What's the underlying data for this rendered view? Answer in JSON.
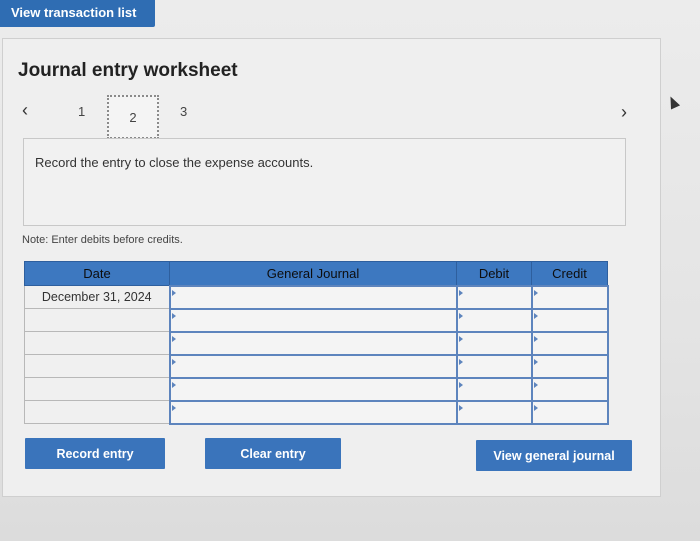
{
  "top": {
    "view_transactions_label": "View transaction list"
  },
  "worksheet": {
    "title": "Journal entry worksheet",
    "steps": [
      "1",
      "2",
      "3"
    ],
    "active_step": "2",
    "instruction": "Record the entry to close the expense accounts.",
    "note": "Note: Enter debits before credits."
  },
  "table": {
    "headers": {
      "date": "Date",
      "general_journal": "General Journal",
      "debit": "Debit",
      "credit": "Credit"
    },
    "rows": [
      {
        "date": "December 31, 2024",
        "account": "",
        "debit": "",
        "credit": ""
      },
      {
        "date": "",
        "account": "",
        "debit": "",
        "credit": ""
      },
      {
        "date": "",
        "account": "",
        "debit": "",
        "credit": ""
      },
      {
        "date": "",
        "account": "",
        "debit": "",
        "credit": ""
      },
      {
        "date": "",
        "account": "",
        "debit": "",
        "credit": ""
      },
      {
        "date": "",
        "account": "",
        "debit": "",
        "credit": ""
      }
    ]
  },
  "buttons": {
    "record_entry": "Record entry",
    "clear_entry": "Clear entry",
    "view_general_journal": "View general journal"
  },
  "icons": {
    "prev": "chevron-left-icon",
    "next": "chevron-right-icon",
    "cursor": "mouse-cursor-icon"
  },
  "colors": {
    "accent": "#3a74bb",
    "header": "#3d78c0"
  }
}
